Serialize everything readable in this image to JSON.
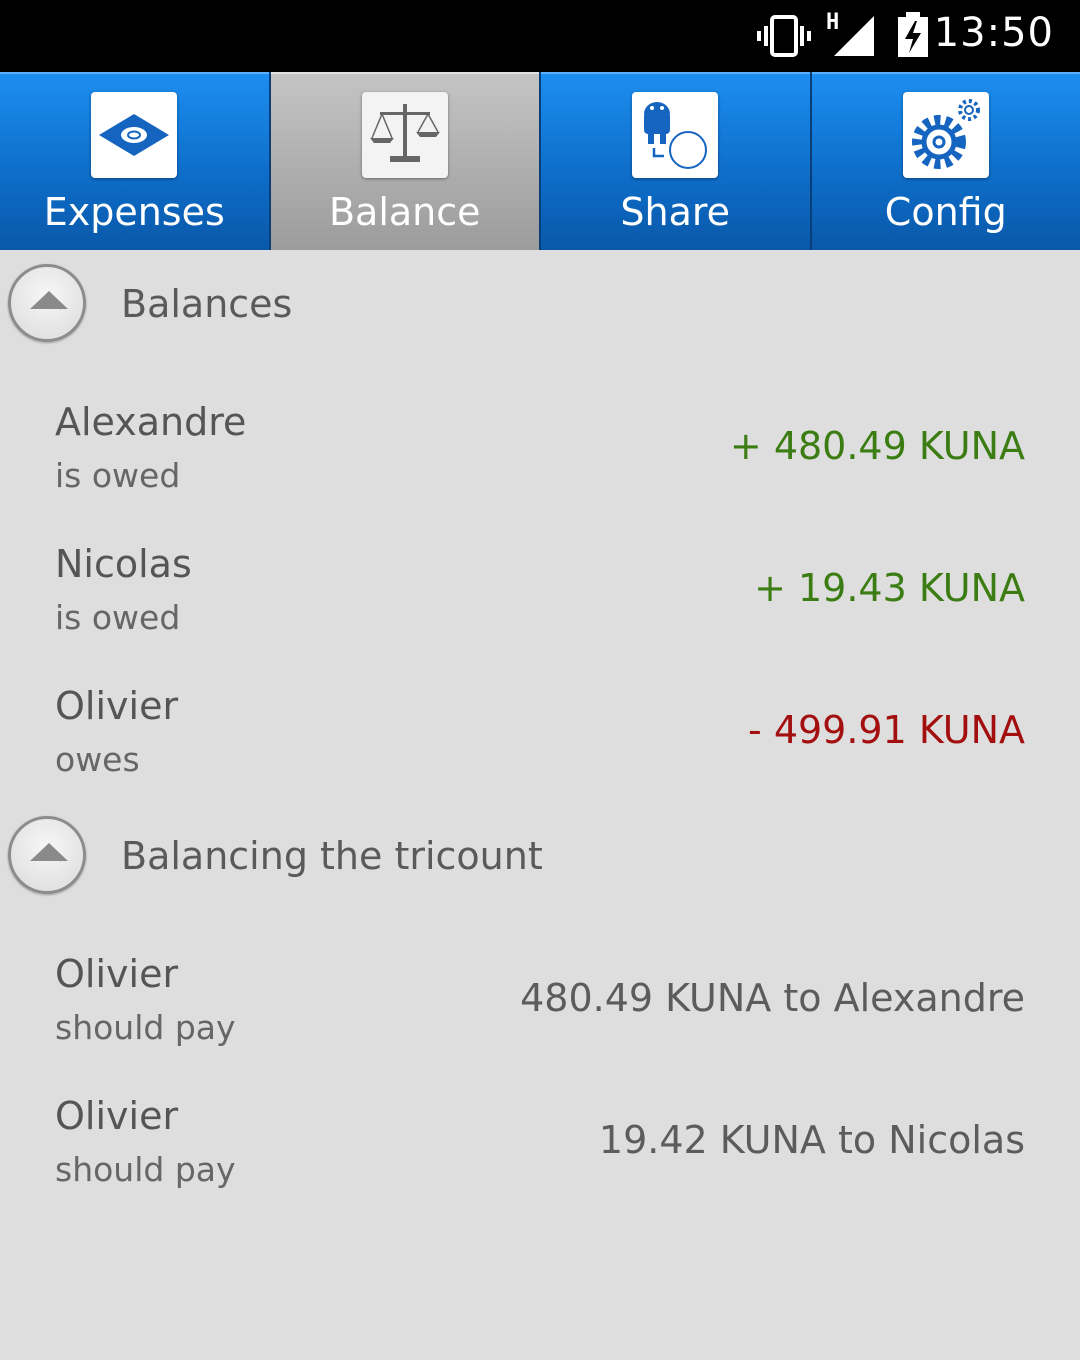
{
  "status_bar": {
    "time": "13:50",
    "network_label": "H",
    "icons": [
      "vibrate-icon",
      "signal-icon",
      "battery-charging-icon"
    ]
  },
  "tabs": [
    {
      "label": "Expenses",
      "icon": "money-note-icon",
      "active": false
    },
    {
      "label": "Balance",
      "icon": "scales-icon",
      "active": true
    },
    {
      "label": "Share",
      "icon": "android-share-icon",
      "active": false
    },
    {
      "label": "Config",
      "icon": "gear-icon",
      "active": false
    }
  ],
  "balances": {
    "title": "Balances",
    "rows": [
      {
        "name": "Alexandre",
        "status": "is owed",
        "amount": "+ 480.49 KUNA",
        "color": "#3b7d13"
      },
      {
        "name": "Nicolas",
        "status": "is owed",
        "amount": "+ 19.43 KUNA",
        "color": "#3b7d13"
      },
      {
        "name": "Olivier",
        "status": "owes",
        "amount": "- 499.91 KUNA",
        "color": "#a30f0f"
      }
    ]
  },
  "balancing": {
    "title": "Balancing the tricount",
    "rows": [
      {
        "name": "Olivier",
        "status": "should pay",
        "amount": "480.49 KUNA to Alexandre"
      },
      {
        "name": "Olivier",
        "status": "should pay",
        "amount": "19.42 KUNA to Nicolas"
      }
    ]
  }
}
